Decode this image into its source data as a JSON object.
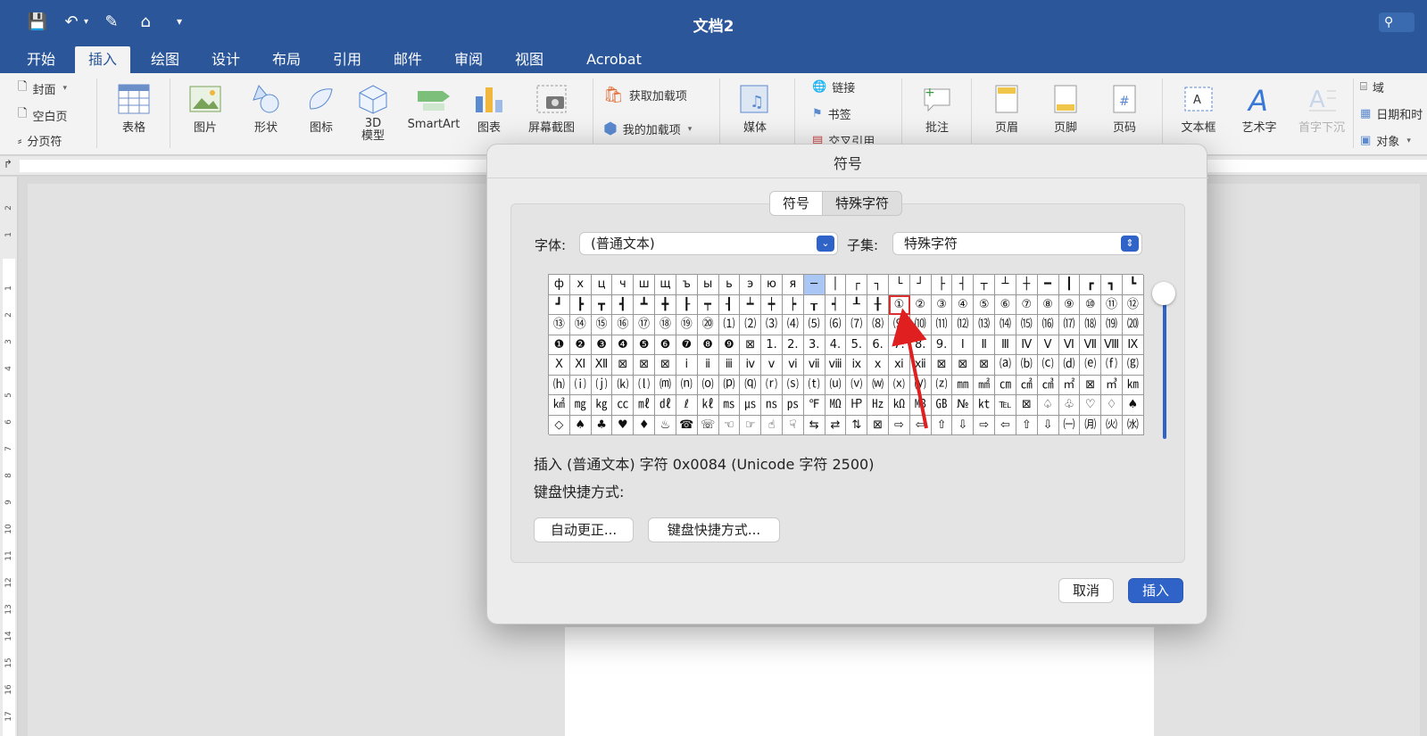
{
  "window": {
    "title": "文档2"
  },
  "qat": {
    "save_icon": "💾",
    "undo_icon": "↶",
    "edit_icon": "✎",
    "home_icon": "⌂",
    "more_icon": "▾"
  },
  "tabs": [
    "开始",
    "插入",
    "绘图",
    "设计",
    "布局",
    "引用",
    "邮件",
    "审阅",
    "视图",
    "Acrobat"
  ],
  "ribbon": {
    "pages": [
      "封面",
      "空白页",
      "分页符"
    ],
    "table": "表格",
    "picture": "图片",
    "shapes": "形状",
    "icons": "图标",
    "model3d": "3D\n模型",
    "smartart": "SmartArt",
    "chart": "图表",
    "screenshot": "屏幕截图",
    "get_addins": "获取加载项",
    "my_addins": "我的加载项",
    "media": "媒体",
    "link": "链接",
    "bookmark": "书签",
    "crossref": "交叉引用",
    "comment": "批注",
    "header": "页眉",
    "footer": "页脚",
    "page_number": "页码",
    "textbox": "文本框",
    "wordart": "艺术字",
    "dropcap": "首字下沉",
    "field": "域",
    "datetime": "日期和时",
    "object": "对象"
  },
  "dialog": {
    "title": "符号",
    "tab_symbols": "符号",
    "tab_special": "特殊字符",
    "font_label": "字体:",
    "font_value": "(普通文本)",
    "subset_label": "子集:",
    "subset_value": "特殊字符",
    "info_line": "插入 (普通文本) 字符 0x0084 (Unicode 字符 2500)",
    "shortcut_label": "键盘快捷方式:",
    "autocorrect_button": "自动更正...",
    "shortcut_button": "键盘快捷方式...",
    "cancel_button": "取消",
    "insert_button": "插入"
  },
  "symbol_grid": [
    [
      "ф",
      "х",
      "ц",
      "ч",
      "ш",
      "щ",
      "ъ",
      "ы",
      "ь",
      "э",
      "ю",
      "я",
      "─",
      "│",
      "┌",
      "┐",
      "└",
      "┘",
      "├",
      "┤",
      "┬",
      "┴",
      "┼",
      "━",
      "┃",
      "┏",
      "┓",
      "┗"
    ],
    [
      "┛",
      "┣",
      "┳",
      "┫",
      "┻",
      "╋",
      "┠",
      "┯",
      "┨",
      "┷",
      "┿",
      "┝",
      "┰",
      "┥",
      "┸",
      "╂",
      "①",
      "②",
      "③",
      "④",
      "⑤",
      "⑥",
      "⑦",
      "⑧",
      "⑨",
      "⑩",
      "⑪",
      "⑫"
    ],
    [
      "⑬",
      "⑭",
      "⑮",
      "⑯",
      "⑰",
      "⑱",
      "⑲",
      "⑳",
      "⑴",
      "⑵",
      "⑶",
      "⑷",
      "⑸",
      "⑹",
      "⑺",
      "⑻",
      "⑼",
      "⑽",
      "⑾",
      "⑿",
      "⒀",
      "⒁",
      "⒂",
      "⒃",
      "⒄",
      "⒅",
      "⒆",
      "⒇"
    ],
    [
      "❶",
      "❷",
      "❸",
      "❹",
      "❺",
      "❻",
      "❼",
      "❽",
      "❾",
      "⊠",
      "1.",
      "2.",
      "3.",
      "4.",
      "5.",
      "6.",
      "7.",
      "8.",
      "9.",
      "Ⅰ",
      "Ⅱ",
      "Ⅲ",
      "Ⅳ",
      "Ⅴ",
      "Ⅵ",
      "Ⅶ",
      "Ⅷ",
      "Ⅸ"
    ],
    [
      "Ⅹ",
      "Ⅺ",
      "Ⅻ",
      "⊠",
      "⊠",
      "⊠",
      "ⅰ",
      "ⅱ",
      "ⅲ",
      "ⅳ",
      "ⅴ",
      "ⅵ",
      "ⅶ",
      "ⅷ",
      "ⅸ",
      "ⅹ",
      "ⅺ",
      "ⅻ",
      "⊠",
      "⊠",
      "⊠",
      "⒜",
      "⒝",
      "⒞",
      "⒟",
      "⒠",
      "⒡",
      "⒢"
    ],
    [
      "⒣",
      "⒤",
      "⒥",
      "⒦",
      "⒧",
      "⒨",
      "⒩",
      "⒪",
      "⒫",
      "⒬",
      "⒭",
      "⒮",
      "⒯",
      "⒰",
      "⒱",
      "⒲",
      "⒳",
      "⒴",
      "⒵",
      "㎜",
      "㎟",
      "㎝",
      "㎠",
      "㎤",
      "㎡",
      "⊠",
      "㎥",
      "㎞"
    ],
    [
      "㎢",
      "㎎",
      "㎏",
      "㏄",
      "㎖",
      "㎗",
      "ℓ",
      "㎘",
      "㎳",
      "㎲",
      "㎱",
      "㎰",
      "℉",
      "㏁",
      "㏋",
      "㎐",
      "㏀",
      "㎆",
      "㎇",
      "№",
      "㏏",
      "℡",
      "⊠",
      "♤",
      "♧",
      "♡",
      "♢",
      "♠"
    ],
    [
      "◇",
      "♠",
      "♣",
      "♥",
      "♦",
      "♨",
      "☎",
      "☏",
      "☜",
      "☞",
      "☝",
      "☟",
      "⇆",
      "⇄",
      "⇅",
      "⊠",
      "⇨",
      "⇦",
      "⇧",
      "⇩",
      "⇨",
      "⇦",
      "⇧",
      "⇩",
      "㈠",
      "㈪",
      "㈫",
      "㈬"
    ]
  ],
  "colors": {
    "accent": "#2b579a",
    "button_blue": "#2f63c8",
    "highlight_red": "#d93030"
  }
}
